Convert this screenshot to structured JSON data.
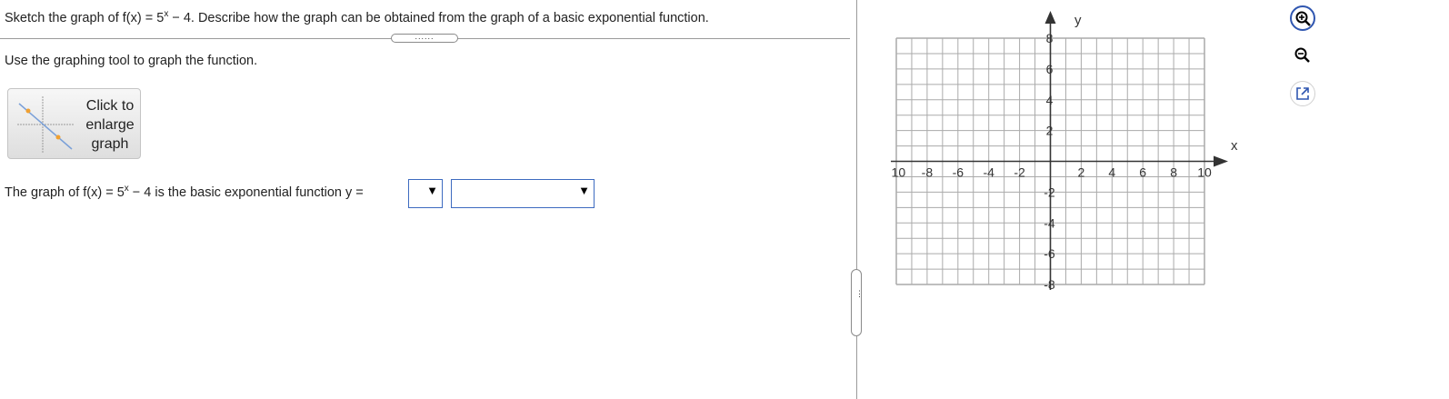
{
  "question": {
    "part1": "Sketch the graph of f(x) = 5",
    "exp": "x",
    "part2": " − 4. Describe how the graph can be obtained from the graph of a basic exponential function."
  },
  "divider_handle": "......",
  "instruction": "Use the graphing tool to graph the function.",
  "enlarge_button": {
    "line1": "Click to",
    "line2": "enlarge",
    "line3": "graph"
  },
  "answer": {
    "part1": "The graph of f(x) = 5",
    "exp": "x",
    "part2": " − 4 is the basic exponential function y =",
    "dropdown1": {
      "selected": "",
      "arrow": "▼"
    },
    "dropdown2": {
      "selected": "",
      "arrow": "▼"
    }
  },
  "split_handle": "⋮",
  "graph": {
    "x_axis_label": "x",
    "y_axis_label": "y",
    "xlim": [
      -10,
      10
    ],
    "ylim": [
      -8,
      8
    ],
    "x_ticks": [
      "-10",
      "-8",
      "-6",
      "-4",
      "-2",
      "2",
      "4",
      "6",
      "8",
      "10"
    ],
    "y_ticks_pos": [
      "8",
      "6",
      "4",
      "2"
    ],
    "y_ticks_neg": [
      "-2",
      "-4",
      "-6",
      "-8"
    ],
    "grid": true,
    "colors": {
      "grid": "#aaaaaa",
      "axis": "#333333",
      "tool_border": "#2f56b0",
      "dropdown_border": "#3d6bc0"
    }
  },
  "tools": [
    {
      "name": "zoom-in",
      "icon": "zoom-in-icon"
    },
    {
      "name": "zoom-out",
      "icon": "zoom-out-icon"
    },
    {
      "name": "expand",
      "icon": "external-window-icon"
    }
  ]
}
